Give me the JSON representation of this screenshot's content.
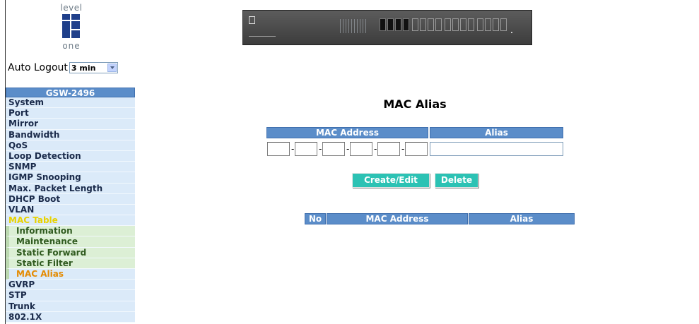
{
  "logo": {
    "top_word": "level",
    "bottom_word": "one"
  },
  "auto_logout": {
    "label": "Auto Logout",
    "selected": "3 min"
  },
  "menu": {
    "header": "GSW-2496",
    "items": [
      {
        "label": "System",
        "sub": false,
        "active": false
      },
      {
        "label": "Port",
        "sub": false,
        "active": false
      },
      {
        "label": "Mirror",
        "sub": false,
        "active": false
      },
      {
        "label": "Bandwidth",
        "sub": false,
        "active": false
      },
      {
        "label": "QoS",
        "sub": false,
        "active": false
      },
      {
        "label": "Loop Detection",
        "sub": false,
        "active": false
      },
      {
        "label": "SNMP",
        "sub": false,
        "active": false
      },
      {
        "label": "IGMP Snooping",
        "sub": false,
        "active": false
      },
      {
        "label": "Max. Packet Length",
        "sub": false,
        "active": false
      },
      {
        "label": "DHCP Boot",
        "sub": false,
        "active": false
      },
      {
        "label": "VLAN",
        "sub": false,
        "active": false
      },
      {
        "label": "MAC Table",
        "sub": false,
        "active": true
      },
      {
        "label": "Information",
        "sub": true,
        "active": false
      },
      {
        "label": "Maintenance",
        "sub": true,
        "active": false
      },
      {
        "label": "Static Forward",
        "sub": true,
        "active": false
      },
      {
        "label": "Static Filter",
        "sub": true,
        "active": false
      },
      {
        "label": "MAC Alias",
        "sub": true,
        "active": true
      },
      {
        "label": "GVRP",
        "sub": false,
        "active": false
      },
      {
        "label": "STP",
        "sub": false,
        "active": false
      },
      {
        "label": "Trunk",
        "sub": false,
        "active": false
      },
      {
        "label": "802.1X",
        "sub": false,
        "active": false
      }
    ]
  },
  "page": {
    "title": "MAC Alias",
    "form": {
      "mac_header": "MAC Address",
      "alias_header": "Alias",
      "mac_octets": [
        "",
        "",
        "",
        "",
        "",
        ""
      ],
      "alias_value": ""
    },
    "buttons": {
      "create_edit": "Create/Edit",
      "delete": "Delete"
    },
    "list_headers": {
      "no": "No",
      "mac": "MAC Address",
      "alias": "Alias"
    }
  },
  "colors": {
    "header_blue": "#5b8dc9",
    "button_teal": "#2cc2b4",
    "active_menu": "#e8d200",
    "active_submenu": "#e48a00"
  }
}
